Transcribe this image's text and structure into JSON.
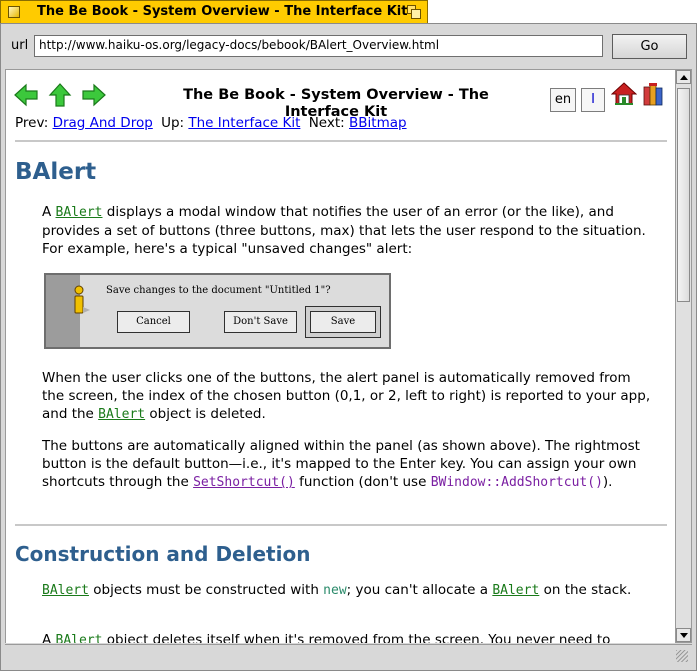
{
  "window": {
    "title": "The Be Book - System Overview - The Interface Kit"
  },
  "urlbar": {
    "label": "url",
    "value": "http://www.haiku-os.org/legacy-docs/bebook/BAlert_Overview.html",
    "go_label": "Go"
  },
  "page": {
    "title": "The Be Book - System Overview - The Interface Kit",
    "lang": "en",
    "index": "I",
    "icons": [
      "back-arrow-icon",
      "up-arrow-icon",
      "forward-arrow-icon",
      "home-icon",
      "book-icon"
    ],
    "nav": {
      "prev_label": "Prev:",
      "prev_link": "Drag And Drop",
      "up_label": "Up:",
      "up_link": "The Interface Kit",
      "next_label": "Next:",
      "next_link": "BBitmap"
    },
    "heading": "BAlert",
    "p1": {
      "a": "A ",
      "cls": "BAlert",
      "b": " displays a modal window that notifies the user of an error (or the like), and provides a set of buttons (three buttons, max) that lets the user respond to the situation. For example, here's a typical \"unsaved changes\" alert:"
    },
    "alert": {
      "message": "Save changes to the document \"Untitled 1\"?",
      "buttons": [
        "Cancel",
        "Don't Save",
        "Save"
      ]
    },
    "p2": {
      "a": "When the user clicks one of the buttons, the alert panel is automatically removed from the screen, the index of the chosen button (0,1, or 2, left to right) is reported to your app, and the ",
      "cls": "BAlert",
      "b": " object is deleted."
    },
    "p3": {
      "a": "The buttons are automatically aligned within the panel (as shown above). The rightmost button is the default button—i.e., it's mapped to the Enter key. You can assign your own shortcuts through the ",
      "meth": "SetShortcut()",
      "b": " function (don't use ",
      "code": "BWindow::AddShortcut()",
      "c": ")."
    },
    "heading2": "Construction and Deletion",
    "p4": {
      "cls1": "BAlert",
      "a": " objects must be constructed with ",
      "kw": "new",
      "b": "; you can't allocate a ",
      "cls2": "BAlert",
      "c": " on the stack."
    },
    "p5": {
      "a": "A ",
      "cls": "BAlert",
      "b": " object deletes itself when it's removed from the screen. You never need to"
    }
  },
  "colors": {
    "tab": "#ffcb00",
    "heading": "#2e5f8e",
    "link": "#0000ee",
    "class_link": "#1a7a1a",
    "method_link": "#7a1fa2"
  }
}
